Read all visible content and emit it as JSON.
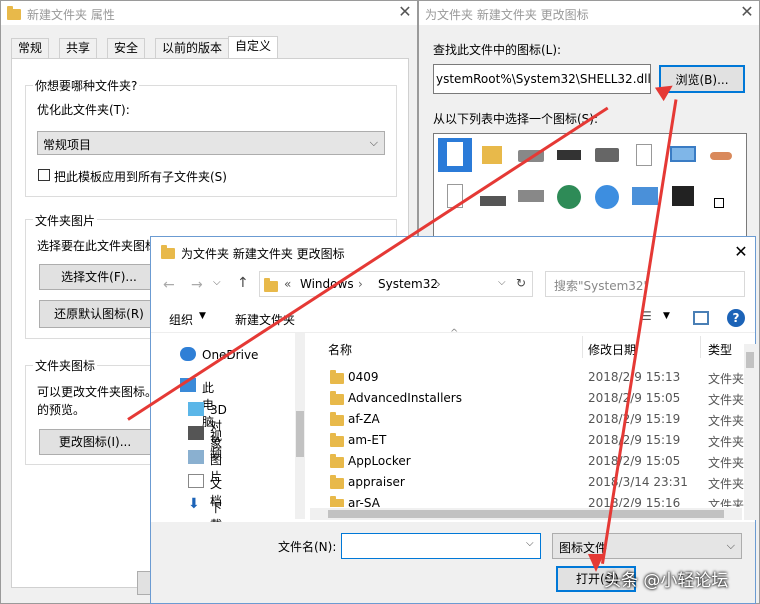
{
  "props_window": {
    "title": "新建文件夹 属性",
    "tabs": [
      "常规",
      "共享",
      "安全",
      "以前的版本",
      "自定义"
    ],
    "question": "你想要哪种文件夹?",
    "optimize_label": "优化此文件夹(T):",
    "optimize_value": "常规项目",
    "apply_sub": "把此模板应用到所有子文件夹(S)",
    "pictures_group": "文件夹图片",
    "choose_text": "选择要在此文件夹图标",
    "choose_btn": "选择文件(F)...",
    "restore_btn": "还原默认图标(R)",
    "icons_group": "文件夹图标",
    "change_text_1": "可以更改文件夹图标。",
    "change_text_2": "的预览。",
    "change_btn": "更改图标(I)..."
  },
  "icon_window": {
    "title": "为文件夹 新建文件夹 更改图标",
    "find_label": "查找此文件中的图标(L):",
    "path_value": "ystemRoot%\\System32\\SHELL32.dll",
    "browse_btn": "浏览(B)...",
    "choose_label": "从以下列表中选择一个图标(S):"
  },
  "open_dialog": {
    "title": "为文件夹 新建文件夹 更改图标",
    "breadcrumb": [
      "«",
      "Windows",
      "System32"
    ],
    "search_placeholder": "搜索\"System32\"",
    "organize": "组织",
    "new_folder": "新建文件夹",
    "nav": [
      "OneDrive",
      "此电脑",
      "3D 对象",
      "视频",
      "图片",
      "文档",
      "下载"
    ],
    "columns": {
      "name": "名称",
      "date": "修改日期",
      "type": "类型"
    },
    "files": [
      {
        "name": "0409",
        "date": "2018/2/9 15:13",
        "type": "文件夹"
      },
      {
        "name": "AdvancedInstallers",
        "date": "2018/2/9 15:05",
        "type": "文件夹"
      },
      {
        "name": "af-ZA",
        "date": "2018/2/9 15:19",
        "type": "文件夹"
      },
      {
        "name": "am-ET",
        "date": "2018/2/9 15:19",
        "type": "文件夹"
      },
      {
        "name": "AppLocker",
        "date": "2018/2/9 15:05",
        "type": "文件夹"
      },
      {
        "name": "appraiser",
        "date": "2018/3/14 23:31",
        "type": "文件夹"
      },
      {
        "name": "ar-SA",
        "date": "2018/2/9 15:16",
        "type": "文件夹"
      }
    ],
    "filename_label": "文件名(N):",
    "filter_value": "图标文件",
    "open_btn": "打开(O)"
  },
  "watermark": "头条 @小轻论坛",
  "colors": {
    "arrow": "#e53935",
    "accent": "#0078d7",
    "folder": "#e8b94a"
  }
}
